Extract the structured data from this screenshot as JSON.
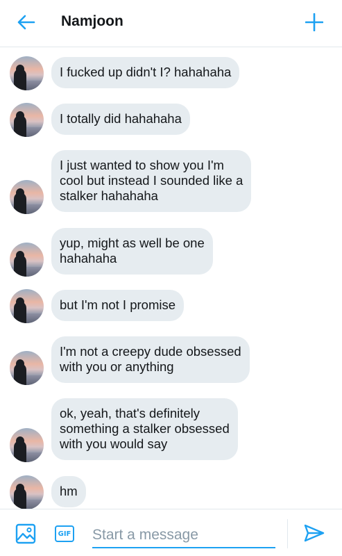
{
  "header": {
    "title": "Namjoon",
    "back_icon": "arrow-left-icon",
    "add_icon": "plus-icon"
  },
  "colors": {
    "accent": "#1da1f2",
    "bubble": "#e6ecf0",
    "text": "#14171a"
  },
  "messages": [
    {
      "text": "I fucked up didn't I? hahahaha"
    },
    {
      "text": "I totally did hahahaha"
    },
    {
      "text": "I just wanted to show you I'm\ncool but instead I sounded like a\nstalker hahahaha"
    },
    {
      "text": "yup, might as well be one\nhahahaha"
    },
    {
      "text": "but I'm not I promise"
    },
    {
      "text": "I'm not a creepy dude obsessed\nwith you or anything"
    },
    {
      "text": "ok, yeah, that's definitely\nsomething a stalker obsessed\nwith you would say"
    },
    {
      "text": "hm"
    }
  ],
  "composer": {
    "placeholder": "Start a message",
    "gif_label": "GIF",
    "image_icon": "image-icon",
    "send_icon": "send-icon"
  }
}
